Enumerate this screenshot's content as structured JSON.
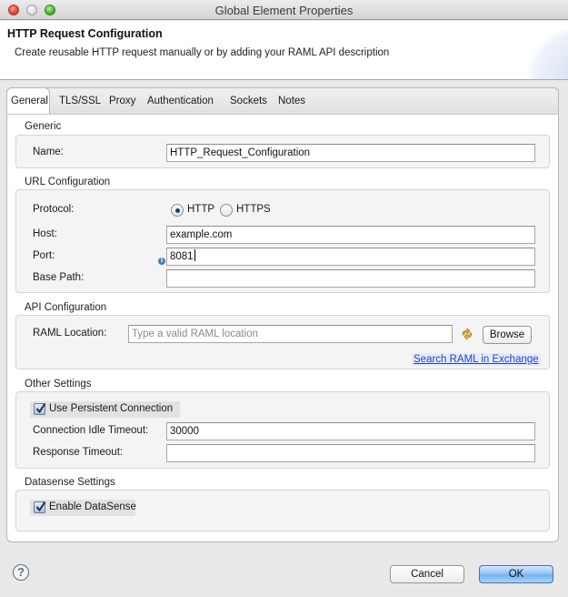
{
  "window": {
    "title": "Global Element Properties",
    "controls": [
      "close",
      "minimize",
      "zoom"
    ]
  },
  "header": {
    "title": "HTTP Request Configuration",
    "description": "Create reusable HTTP request manually or by adding your RAML API description"
  },
  "tabs": [
    {
      "label": "General",
      "active": true
    },
    {
      "label": "TLS/SSL",
      "active": false
    },
    {
      "label": "Proxy",
      "active": false
    },
    {
      "label": "Authentication",
      "active": false
    },
    {
      "label": "Sockets",
      "active": false
    },
    {
      "label": "Notes",
      "active": false
    }
  ],
  "generic": {
    "section_label": "Generic",
    "name_label": "Name:",
    "name_value": "HTTP_Request_Configuration"
  },
  "url_config": {
    "section_label": "URL Configuration",
    "protocol_label": "Protocol:",
    "protocol_options": [
      {
        "label": "HTTP",
        "selected": true
      },
      {
        "label": "HTTPS",
        "selected": false
      }
    ],
    "host_label": "Host:",
    "host_value": "example.com",
    "port_label": "Port:",
    "port_value": "8081",
    "port_info_icon": "info-icon",
    "base_path_label": "Base Path:",
    "base_path_value": ""
  },
  "api_config": {
    "section_label": "API Configuration",
    "raml_label": "RAML Location:",
    "raml_value": "",
    "raml_placeholder": "Type a valid RAML location",
    "refresh_icon": "refresh-icon",
    "browse_label": "Browse",
    "search_link": "Search RAML in Exchange"
  },
  "other_settings": {
    "section_label": "Other Settings",
    "persistent_label": "Use Persistent Connection",
    "persistent_checked": true,
    "idle_timeout_label": "Connection Idle Timeout:",
    "idle_timeout_value": "30000",
    "response_timeout_label": "Response Timeout:",
    "response_timeout_value": ""
  },
  "datasense": {
    "section_label": "Datasense Settings",
    "enable_label": "Enable DataSense",
    "enable_checked": true
  },
  "footer": {
    "help_icon": "help-icon",
    "cancel_label": "Cancel",
    "ok_label": "OK"
  }
}
